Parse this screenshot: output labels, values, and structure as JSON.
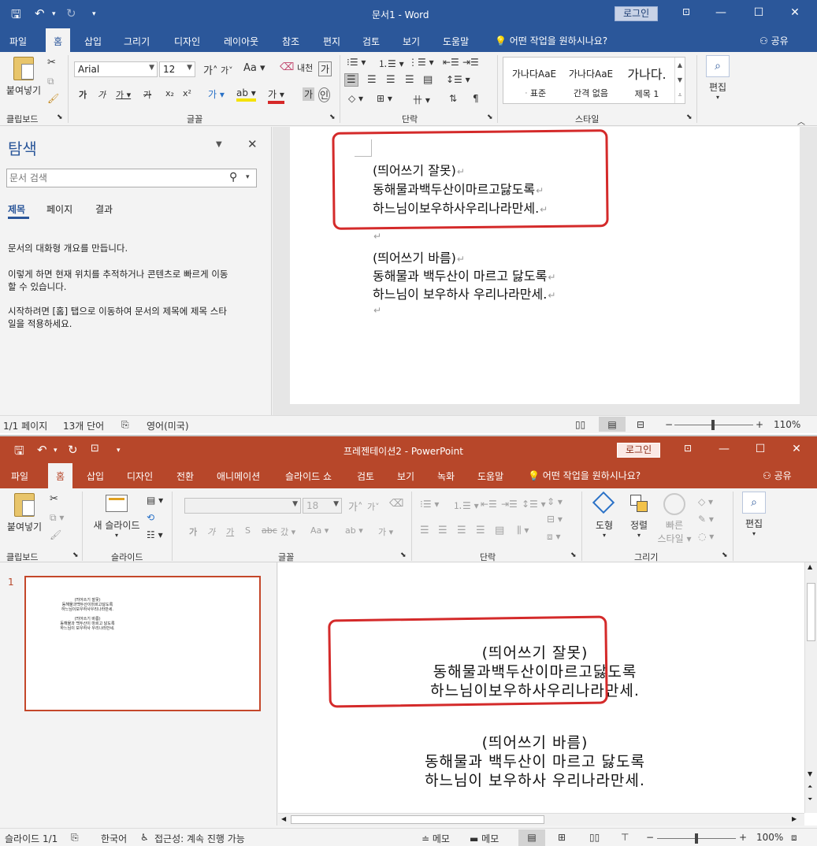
{
  "word": {
    "title": "문서1 - Word",
    "login": "로그인",
    "tabs": [
      "파일",
      "홈",
      "삽입",
      "그리기",
      "디자인",
      "레이아웃",
      "참조",
      "편지",
      "검토",
      "보기",
      "도움말"
    ],
    "tell_me": "어떤 작업을 원하시나요?",
    "share": "공유",
    "ribbon": {
      "paste": "붙여넣기",
      "font_name": "Arial",
      "font_size": "12",
      "styles": [
        {
          "preview": "가나다AaE",
          "name": "ᆞ표준"
        },
        {
          "preview": "가나다AaE",
          "name": "간격 없음"
        },
        {
          "preview": "가나다.",
          "name": "제목 1"
        }
      ],
      "edit": "편집",
      "groups": [
        "클립보드",
        "글꼴",
        "단락",
        "스타일"
      ]
    },
    "nav": {
      "title": "탐색",
      "search_placeholder": "문서 검색",
      "tabs": [
        "제목",
        "페이지",
        "결과"
      ],
      "p1": "문서의 대화형 개요를 만듭니다.",
      "p2a": "이렇게 하면 현재 위치를 추적하거나 콘텐츠로 빠르게 이동",
      "p2b": "할 수 있습니다.",
      "p3a": "시작하려면 [홈] 탭으로 이동하여 문서의 제목에 제목 스타",
      "p3b": "일을 적용하세요."
    },
    "doc_lines": [
      "(띄어쓰기 잘못)",
      "동해물과백두산이마르고닳도록",
      "하느님이보우하사우리나라만세.",
      "",
      "(띄어쓰기 바름)",
      "동해물과 백두산이 마르고 닳도록",
      "하느님이 보우하사 우리나라만세.",
      ""
    ],
    "status": {
      "page": "1/1 페이지",
      "words": "13개 단어",
      "lang": "영어(미국)",
      "zoom": "110%"
    }
  },
  "ppt": {
    "title": "프레젠테이션2 - PowerPoint",
    "login": "로그인",
    "tabs": [
      "파일",
      "홈",
      "삽입",
      "디자인",
      "전환",
      "애니메이션",
      "슬라이드 쇼",
      "검토",
      "보기",
      "녹화",
      "도움말"
    ],
    "tell_me": "어떤 작업을 원하시나요?",
    "share": "공유",
    "ribbon": {
      "paste": "붙여넣기",
      "new_slide": "새 슬라이드",
      "font_size": "18",
      "shape": "도형",
      "arrange": "정렬",
      "quick_style_1": "빠른",
      "quick_style_2": "스타일",
      "edit": "편집",
      "groups": [
        "클립보드",
        "슬라이드",
        "글꼴",
        "단락",
        "그리기"
      ]
    },
    "slide_number": "1",
    "slide_lines": [
      "(띄어쓰기 잘못)",
      "동해물과백두산이마르고닳도록",
      "하느님이보우하사우리나라만세.",
      "(띄어쓰기 바름)",
      "동해물과 백두산이 마르고 닳도록",
      "하느님이 보우하사 우리나라만세."
    ],
    "status": {
      "slide": "슬라이드 1/1",
      "lang": "한국어",
      "access": "접근성: 계속 진행 가능",
      "notes": "메모",
      "comments": "메모",
      "zoom": "100%"
    }
  }
}
